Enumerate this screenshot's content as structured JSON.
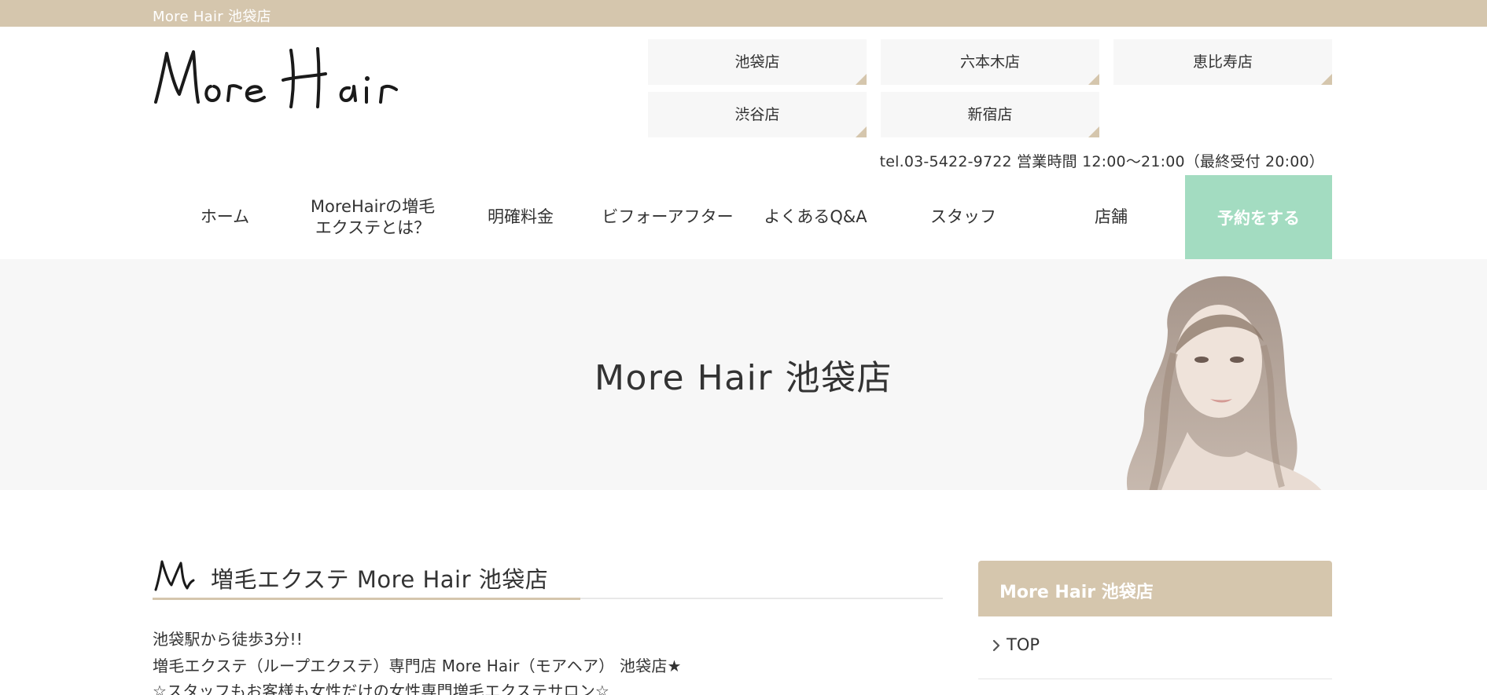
{
  "topbar": {
    "title": "More Hair 池袋店"
  },
  "header": {
    "logo": "More Hair",
    "tel_line": "tel.03-5422-9722 営業時間 12:00～21:00（最終受付 20:00）"
  },
  "shops": [
    {
      "label": "池袋店"
    },
    {
      "label": "六本木店"
    },
    {
      "label": "恵比寿店"
    },
    {
      "label": "渋谷店"
    },
    {
      "label": "新宿店"
    }
  ],
  "nav": {
    "items": [
      {
        "label": "ホーム"
      },
      {
        "label_line1": "MoreHairの増毛",
        "label_line2": "エクステとは？"
      },
      {
        "label": "明確料金"
      },
      {
        "label": "ビフォーアフター"
      },
      {
        "label": "よくあるQ&A"
      },
      {
        "label": "スタッフ"
      },
      {
        "label": "店舗"
      }
    ],
    "reserve_label": "予約をする"
  },
  "hero": {
    "title": "More Hair 池袋店"
  },
  "main": {
    "section_title": "増毛エクステ More Hair 池袋店",
    "lines": [
      "池袋駅から徒歩3分!!",
      "増毛エクステ（ループエクステ）専門店 More Hair（モアヘア） 池袋店★",
      "☆スタッフもお客様も女性だけの女性専門増毛エクステサロン☆"
    ]
  },
  "sidebar": {
    "title": "More Hair 池袋店",
    "items": [
      {
        "label": "TOP"
      }
    ]
  },
  "colors": {
    "beige": "#d5c6ad",
    "mint": "#a3dcc1",
    "light_gray": "#f7f7f7",
    "text": "#333333"
  }
}
